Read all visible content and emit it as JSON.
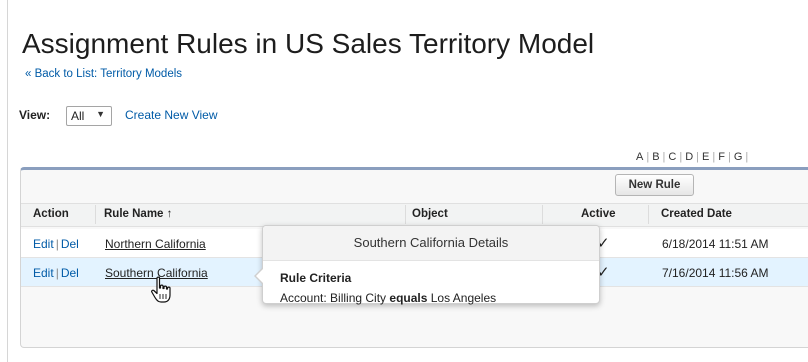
{
  "page": {
    "title": "Assignment Rules in US Sales Territory Model",
    "back_link": "« Back to List: Territory Models"
  },
  "view": {
    "label": "View:",
    "selected": "All",
    "create_link": "Create New View"
  },
  "alphabet": [
    "A",
    "B",
    "C",
    "D",
    "E",
    "F",
    "G"
  ],
  "table": {
    "new_button": "New Rule",
    "columns": {
      "action": "Action",
      "rule_name": "Rule Name ↑",
      "object": "Object",
      "active": "Active",
      "created": "Created Date"
    },
    "rows": [
      {
        "edit": "Edit",
        "del": "Del",
        "name": "Northern California",
        "active": "✓",
        "created": "6/18/2014 11:51 AM"
      },
      {
        "edit": "Edit",
        "del": "Del",
        "name": "Southern California",
        "active": "✓",
        "created": "7/16/2014 11:56 AM"
      }
    ]
  },
  "popover": {
    "title": "Southern California Details",
    "section": "Rule Criteria",
    "criteria_field": "Account: Billing City",
    "criteria_operator": "equals",
    "criteria_value": "Los Angeles"
  },
  "colors": {
    "link": "#015ba7",
    "header_accent": "#8a9ebe",
    "highlight_row": "#e3f3ff"
  }
}
